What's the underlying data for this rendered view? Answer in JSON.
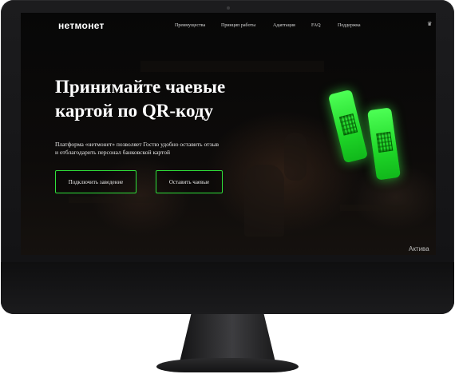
{
  "header": {
    "logo": "нетмонет",
    "nav": [
      "Преимущества",
      "Принцип работы",
      "Адаптация",
      "FAQ",
      "Поддержка"
    ]
  },
  "hero": {
    "title_line1": "Принимайте чаевые",
    "title_line2": "картой по QR-коду",
    "desc_line1": "Платформа «нетмонет» позволяет Гостю удобно оставить отзыв",
    "desc_line2": "и отблагодарить персонал банковской картой",
    "btn_connect": "Подключить заведение",
    "btn_tip": "Оставить чаевые"
  },
  "overlay": {
    "activate_text": "Актива"
  },
  "colors": {
    "accent": "#2fe03a",
    "phone": "#33ff44"
  },
  "icons": {
    "nav_right": "crown-icon",
    "qr": "qr-code-icon"
  }
}
